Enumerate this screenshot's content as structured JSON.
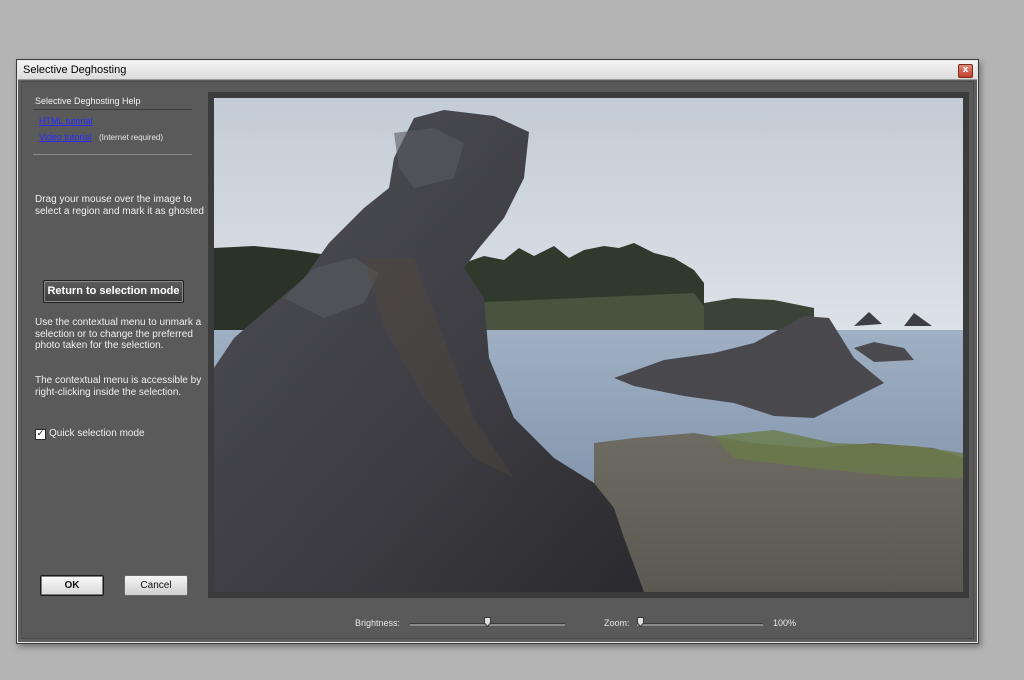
{
  "window": {
    "title": "Selective Deghosting",
    "close_label": "x"
  },
  "help": {
    "title": "Selective Deghosting Help",
    "html_tutorial": "HTML tutorial",
    "video_tutorial": "Video tutorial",
    "internet_note": "(Internet required)"
  },
  "instructions": {
    "drag_text": "Drag your mouse over the image to select a region and mark it as ghosted",
    "contextual_text": "Use the contextual menu to unmark a selection or to change the preferred photo taken for the selection.",
    "rightclick_text": "The contextual menu is accessible by right-clicking inside the selection."
  },
  "buttons": {
    "return_mode": "Return to selection mode",
    "ok": "OK",
    "cancel": "Cancel"
  },
  "quick_selection": {
    "label": "Quick selection mode",
    "checked": true,
    "check_glyph": "✓"
  },
  "controls": {
    "brightness_label": "Brightness:",
    "brightness_value": 0.5,
    "zoom_label": "Zoom:",
    "zoom_value": 0,
    "zoom_text": "100%"
  },
  "icons": {
    "close": "close-icon",
    "slider_thumb": "slider-thumb-icon",
    "checkbox": "checkmark-icon"
  },
  "colors": {
    "window_bg": "#5e5e5e",
    "link": "#2a2aff",
    "desktop": "#b4b4b4"
  }
}
